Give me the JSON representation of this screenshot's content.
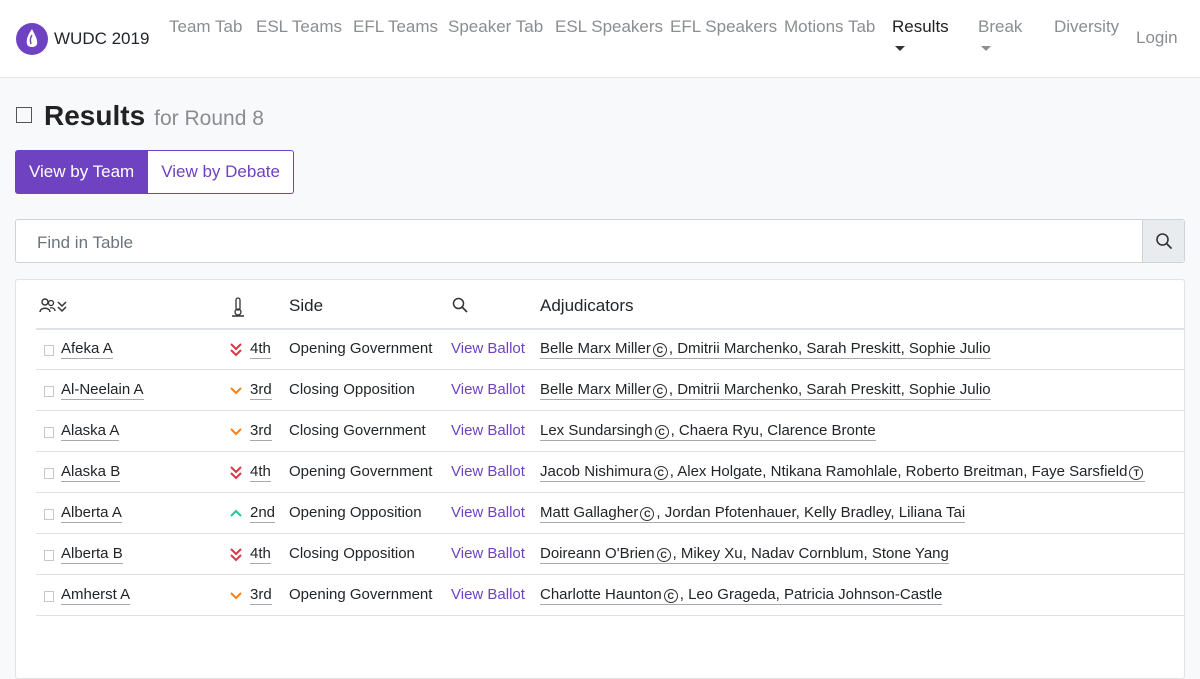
{
  "brand": {
    "name": "WUDC 2019"
  },
  "nav": [
    {
      "id": "team-tab",
      "label": "Team Tab"
    },
    {
      "id": "esl-teams",
      "label": "ESL Teams"
    },
    {
      "id": "efl-teams",
      "label": "EFL Teams"
    },
    {
      "id": "speaker-tab",
      "label": "Speaker Tab"
    },
    {
      "id": "esl-speakers",
      "label": "ESL Speakers"
    },
    {
      "id": "efl-speakers",
      "label": "EFL Speakers"
    },
    {
      "id": "motions-tab",
      "label": "Motions Tab"
    },
    {
      "id": "results",
      "label": "Results",
      "active": true
    },
    {
      "id": "break",
      "label": "Break"
    },
    {
      "id": "diversity",
      "label": "Diversity"
    },
    {
      "id": "login",
      "label": "Login"
    }
  ],
  "page": {
    "title": "Results",
    "subtitle": "for Round 8"
  },
  "view_buttons": {
    "by_team": "View by Team",
    "by_debate": "View by Debate"
  },
  "search": {
    "placeholder": "Find in Table"
  },
  "table": {
    "headers": {
      "side": "Side",
      "adjudicators": "Adjudicators"
    },
    "rows": [
      {
        "team": "Afeka A",
        "rank": "4th",
        "rank_icon": "double-chevron-down-icon",
        "side": "Opening Government",
        "ballot": "View Ballot",
        "chair": "Belle Marx Miller",
        "chair_mark": "C",
        "adjs_rest": ", Dmitrii Marchenko, Sarah Preskitt, Sophie Julio",
        "trainee": ""
      },
      {
        "team": "Al-Neelain A",
        "rank": "3rd",
        "rank_icon": "chevron-down-icon",
        "side": "Closing Opposition",
        "ballot": "View Ballot",
        "chair": "Belle Marx Miller",
        "chair_mark": "C",
        "adjs_rest": ", Dmitrii Marchenko, Sarah Preskitt, Sophie Julio",
        "trainee": ""
      },
      {
        "team": "Alaska A",
        "rank": "3rd",
        "rank_icon": "chevron-down-icon",
        "side": "Closing Government",
        "ballot": "View Ballot",
        "chair": "Lex Sundarsingh",
        "chair_mark": "C",
        "adjs_rest": ", Chaera Ryu, Clarence Bronte",
        "trainee": ""
      },
      {
        "team": "Alaska B",
        "rank": "4th",
        "rank_icon": "double-chevron-down-icon",
        "side": "Opening Government",
        "ballot": "View Ballot",
        "chair": "Jacob Nishimura",
        "chair_mark": "C",
        "adjs_rest": ", Alex Holgate, Ntikana Ramohlale, Roberto Breitman, Faye Sarsfield",
        "trainee": "T"
      },
      {
        "team": "Alberta A",
        "rank": "2nd",
        "rank_icon": "chevron-up-icon",
        "side": "Opening Opposition",
        "ballot": "View Ballot",
        "chair": "Matt Gallagher",
        "chair_mark": "C",
        "adjs_rest": ", Jordan Pfotenhauer, Kelly Bradley, Liliana Tai",
        "trainee": ""
      },
      {
        "team": "Alberta B",
        "rank": "4th",
        "rank_icon": "double-chevron-down-icon",
        "side": "Closing Opposition",
        "ballot": "View Ballot",
        "chair": "Doireann O'Brien",
        "chair_mark": "C",
        "adjs_rest": ", Mikey Xu, Nadav Cornblum, Stone Yang",
        "trainee": ""
      },
      {
        "team": "Amherst A",
        "rank": "3rd",
        "rank_icon": "chevron-down-icon",
        "side": "Opening Government",
        "ballot": "View Ballot",
        "chair": "Charlotte Haunton",
        "chair_mark": "C",
        "adjs_rest": ", Leo Grageda, Patricia Johnson-Castle",
        "trainee": ""
      }
    ]
  },
  "colors": {
    "accent": "#6f42c1",
    "rank_down": "#dc3545",
    "rank_mid": "#fd7e14",
    "rank_up": "#20c997"
  }
}
